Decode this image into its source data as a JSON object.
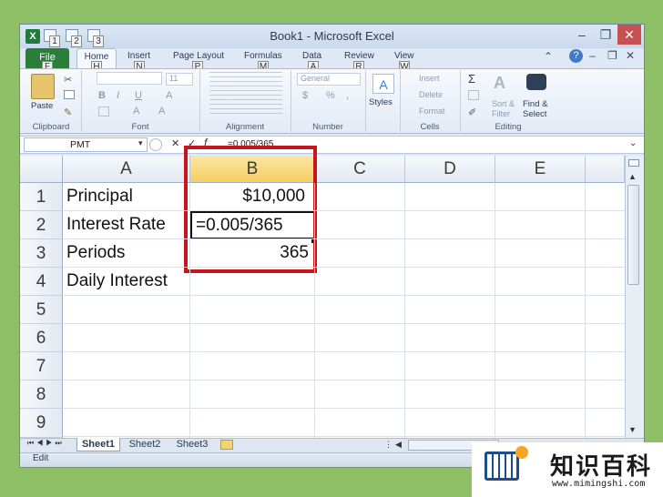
{
  "window": {
    "title": "Book1 - Microsoft Excel",
    "app_icon_text": "X",
    "qat_keytips": [
      "1",
      "2",
      "3"
    ],
    "controls": [
      "–",
      "❐",
      "✕"
    ],
    "doc_controls": [
      "–",
      "?",
      "–",
      "❐",
      "✕"
    ]
  },
  "ribbon_tabs": [
    {
      "label": "File",
      "keytip": "F"
    },
    {
      "label": "Home",
      "keytip": "H"
    },
    {
      "label": "Insert",
      "keytip": "N"
    },
    {
      "label": "Page Layout",
      "keytip": "P"
    },
    {
      "label": "Formulas",
      "keytip": "M"
    },
    {
      "label": "Data",
      "keytip": "A"
    },
    {
      "label": "Review",
      "keytip": "R"
    },
    {
      "label": "View",
      "keytip": "W"
    }
  ],
  "ribbon": {
    "clipboard": {
      "label": "Clipboard",
      "paste": "Paste"
    },
    "font": {
      "label": "Font",
      "size": "11",
      "buttons": [
        "B",
        "I",
        "U",
        "A",
        "A",
        "A"
      ]
    },
    "alignment": {
      "label": "Alignment"
    },
    "number": {
      "label": "Number",
      "format": "General",
      "symbols": [
        "$",
        "%",
        ","
      ]
    },
    "styles": {
      "label": "Styles"
    },
    "cells": {
      "label": "Cells",
      "insert": "Insert",
      "delete": "Delete",
      "format": "Format"
    },
    "editing": {
      "label": "Editing",
      "sigma": "Σ",
      "sort": "Sort &",
      "filter": "Filter",
      "find": "Find &",
      "select": "Select"
    }
  },
  "formula_bar": {
    "name_box": "PMT",
    "cancel": "✕",
    "enter": "✓",
    "fx": "f",
    "formula": "=0.005/365"
  },
  "columns": [
    "A",
    "B",
    "C",
    "D",
    "E"
  ],
  "rows": [
    "1",
    "2",
    "3",
    "4",
    "5",
    "6",
    "7",
    "8",
    "9"
  ],
  "cells": {
    "A1": "Principal",
    "B1": "$10,000",
    "A2": "Interest Rate",
    "B2": "=0.005/365",
    "A3": "Periods",
    "B3": "365",
    "A4": "Daily Interest"
  },
  "sheets": [
    "Sheet1",
    "Sheet2",
    "Sheet3"
  ],
  "status": {
    "mode": "Edit"
  },
  "watermark": {
    "title": "知识百科",
    "url": "www.mimingshi.com"
  },
  "colors": {
    "highlight": "#c4171d",
    "file_tab": "#2d7d3a",
    "selected_col_header": "#f9d867"
  }
}
